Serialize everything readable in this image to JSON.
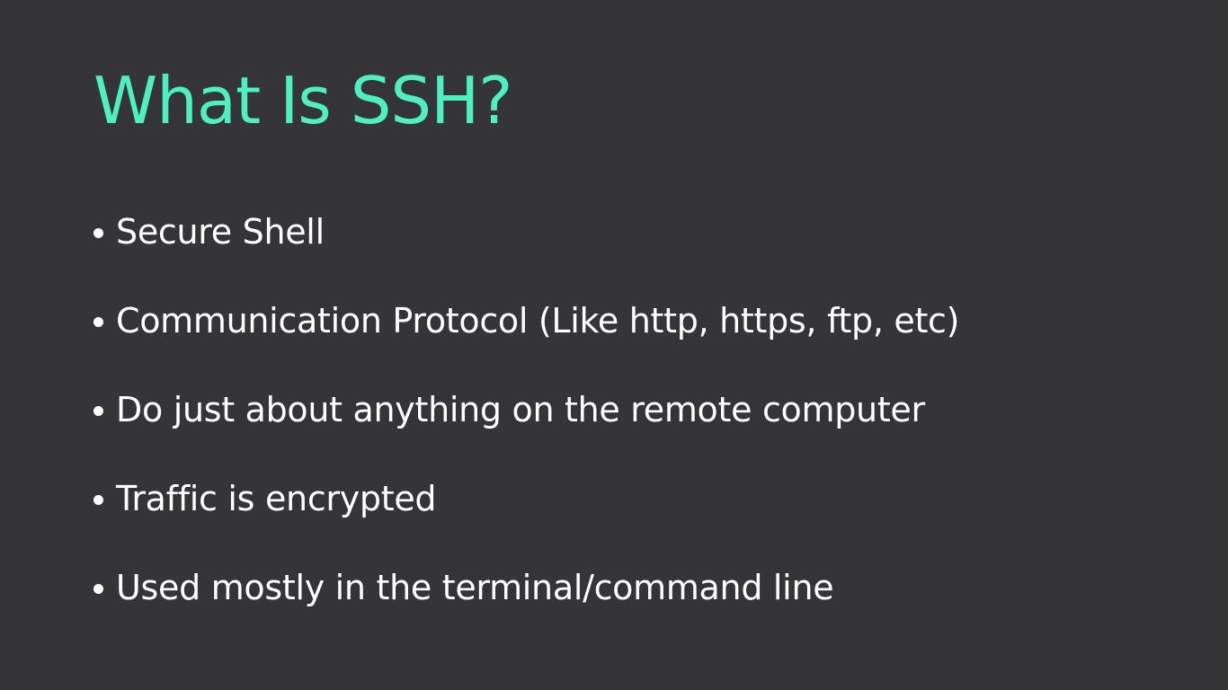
{
  "slide": {
    "title": "What Is SSH?",
    "bullets": [
      "Secure Shell",
      "Communication Protocol (Like http, https, ftp, etc)",
      "Do just about anything on the remote computer",
      "Traffic is encrypted",
      "Used mostly in the terminal/command line"
    ]
  },
  "colors": {
    "background": "#353538",
    "title": "#4ef0c0",
    "text": "#ffffff"
  }
}
